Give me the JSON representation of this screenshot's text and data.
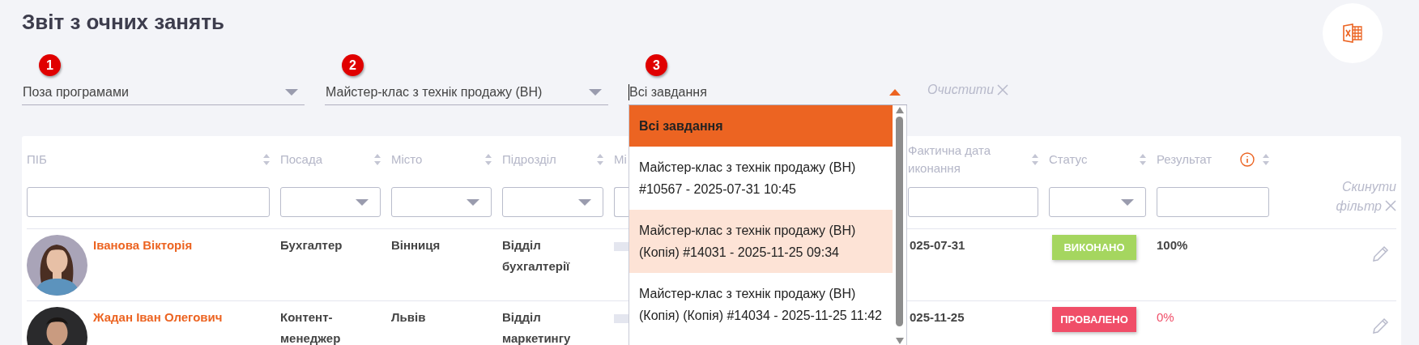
{
  "title": "Звіт з очних занять",
  "filters": [
    {
      "step": "1",
      "value": "Поза програмами",
      "open": false,
      "focused": false
    },
    {
      "step": "2",
      "value": "Майстер-клас з технік продажу (ВН)",
      "open": false,
      "focused": false
    },
    {
      "step": "3",
      "value": "Всі завдання",
      "open": true,
      "focused": true
    }
  ],
  "clear_link": "Очистити",
  "task_dropdown": {
    "options": [
      {
        "label": "Всі завдання",
        "selected": true,
        "highlighted": false
      },
      {
        "label": "Майстер-клас з технік продажу (ВН) #10567 - 2025-07-31 10:45",
        "selected": false,
        "highlighted": false
      },
      {
        "label": "Майстер-клас з технік продажу (ВН) (Копія) #14031 - 2025-11-25 09:34",
        "selected": false,
        "highlighted": true
      },
      {
        "label": "Майстер-клас з технік продажу (ВН) (Копія) (Копія) #14034 - 2025-11-25 11:42",
        "selected": false,
        "highlighted": false
      }
    ]
  },
  "table": {
    "columns": [
      {
        "label": "ПІБ",
        "sortable": true,
        "kind": "text",
        "hint": false
      },
      {
        "label": "Посада",
        "sortable": true,
        "kind": "select",
        "hint": false
      },
      {
        "label": "Місто",
        "sortable": true,
        "kind": "select",
        "hint": false
      },
      {
        "label": "Підрозділ",
        "sortable": true,
        "kind": "select",
        "hint": false
      },
      {
        "label": "Мі",
        "kind": "select"
      },
      {
        "label": "Фактична дата иконання",
        "sortable": true,
        "kind": "text",
        "hint": false
      },
      {
        "label": "Статус",
        "sortable": true,
        "kind": "select",
        "hint": false
      },
      {
        "label": "Результат",
        "sortable": true,
        "kind": "text",
        "hint": true
      }
    ],
    "reset_filter": "Скинути фільтр",
    "rows": [
      {
        "name": "Іванова Вікторія",
        "position": "Бухгалтер",
        "city": "Вінниця",
        "department": "Відділ бухгалтерії",
        "tagged": true,
        "date": "025-07-31",
        "status": {
          "label": "ВИКОНАНО",
          "kind": "done"
        },
        "result": "100%",
        "editable": true
      },
      {
        "name": "Жадан Іван Олегович",
        "position": "Контент-менеджер",
        "city": "Львів",
        "department": "Відділ маркетингу",
        "tagged": true,
        "date": "025-11-25",
        "status": {
          "label": "ПРОВАЛЕНО",
          "kind": "failed"
        },
        "result": "0%",
        "editable": true
      }
    ]
  }
}
